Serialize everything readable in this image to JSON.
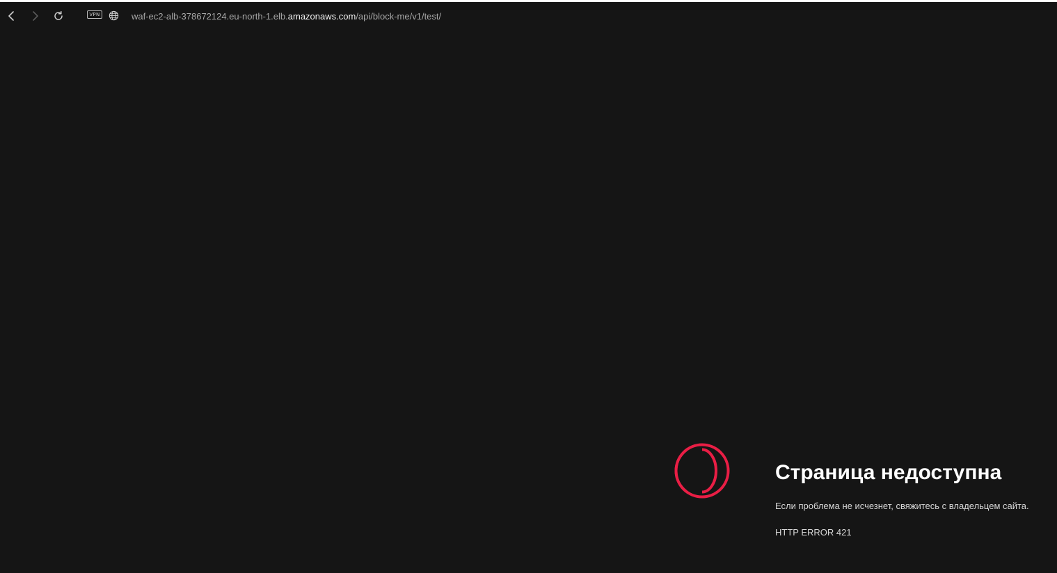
{
  "browser": {
    "url_prefix": "waf-ec2-alb-378672124.eu-north-1.elb.",
    "url_host": "amazonaws.com",
    "url_path": "/api/block-me/v1/test/",
    "vpn_label": "VPN",
    "icons": [
      "back-arrow-icon",
      "forward-arrow-icon",
      "reload-icon",
      "vpn-badge",
      "globe-icon"
    ]
  },
  "error_page": {
    "title": "Страница недоступна",
    "description": "Если проблема не исчезнет, свяжитесь с владельцем сайта.",
    "code": "HTTP ERROR 421",
    "logo_icon": "opera-logo-icon",
    "accent_color": "#e91e45"
  }
}
